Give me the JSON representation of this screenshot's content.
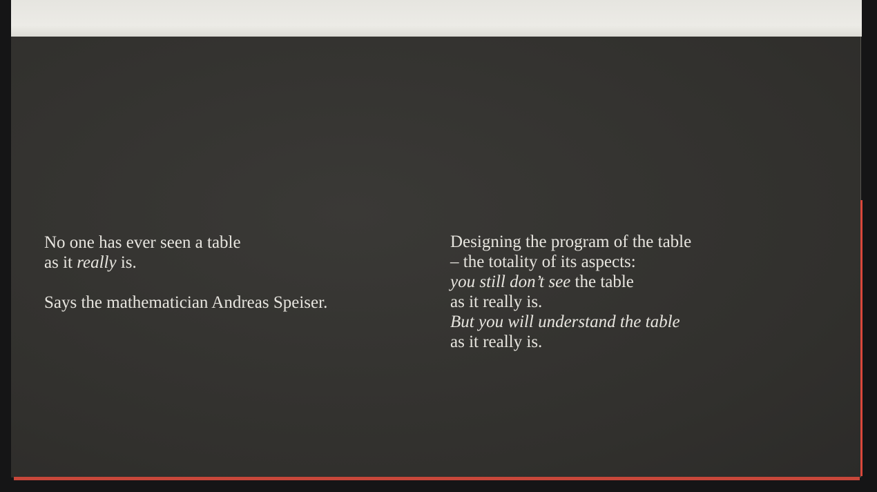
{
  "left_column": {
    "line1": "No one has ever seen a table",
    "line2_a": "as it ",
    "line2_italic": "really",
    "line2_b": " is.",
    "line3": "Says the mathematician Andreas Speiser."
  },
  "right_column": {
    "line1": "Designing the program of the table",
    "line2": "– the totality of its aspects:",
    "line3_italic": "you still don’t see",
    "line3_b": " the table",
    "line4": "as it really is.",
    "line5_italic": "But you will understand the table",
    "line6": "as it really is."
  },
  "colors": {
    "page": "#33322f",
    "text": "#e7e5df",
    "edge": "#c8473a"
  }
}
